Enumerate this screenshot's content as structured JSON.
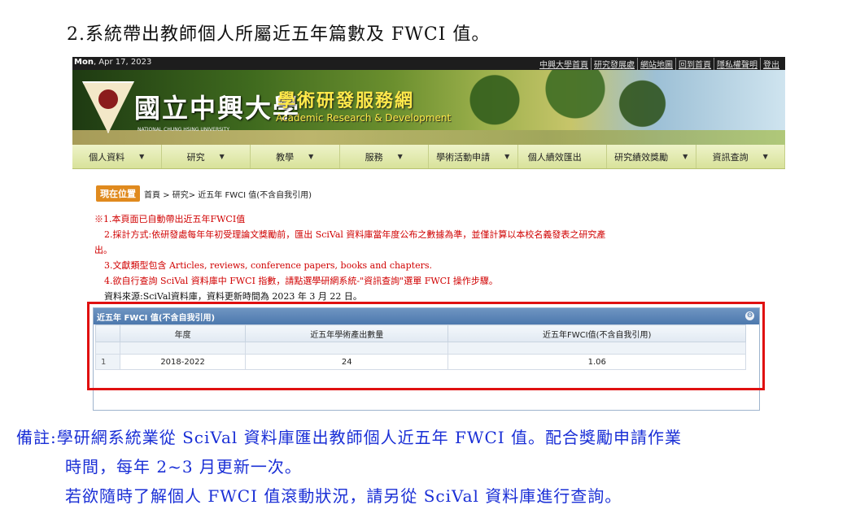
{
  "doc": {
    "heading": "2.系統帶出教師個人所屬近五年篇數及 FWCI 值。",
    "remark_line1": "備註:學研網系統業從 SciVal 資料庫匯出教師個人近五年 FWCI 值。配合獎勵申請作業",
    "remark_line2": "時間，每年 2~3 月更新一次。",
    "remark_line3": "若欲隨時了解個人 FWCI 值滾動狀況，請另從 SciVal 資料庫進行查詢。"
  },
  "site": {
    "day": "Mon",
    "date": ", Apr 17, 2023",
    "top_links": [
      "中興大學首頁",
      "研究發展處",
      "網站地圖",
      "回到首頁",
      "隱私權聲明",
      "登出"
    ],
    "univ_name": "國立中興大學",
    "univ_sub": "NATIONAL CHUNG HSING UNIVERSITY",
    "site_name": "學術研發服務網",
    "site_en": "Academic Research & Development",
    "menu": [
      {
        "label": "個人資料",
        "arrow": "▼"
      },
      {
        "label": "研究",
        "arrow": "▼"
      },
      {
        "label": "教學",
        "arrow": "▼"
      },
      {
        "label": "服務",
        "arrow": "▼"
      },
      {
        "label": "學術活動申請",
        "arrow": "▼"
      },
      {
        "label": "個人績效匯出",
        "arrow": ""
      },
      {
        "label": "研究績效獎勵",
        "arrow": "▼"
      },
      {
        "label": "資訊查詢",
        "arrow": "▼"
      }
    ],
    "breadcrumb_badge": "現在位置",
    "breadcrumb": "首頁 > 研究> 近五年 FWCI 值(不含自我引用)",
    "notes": {
      "n1": "※1.本頁面已自動帶出近五年FWCI值",
      "n2a": "2.採計方式:依研發處每年年初受理論文獎勵前，匯出 SciVal 資料庫當年度公布之數據為準，並僅計算以本校名義發表之研究產",
      "n2b": "出。",
      "n3": "3.文獻類型包含 Articles, reviews, conference papers, books and chapters.",
      "n4": "4.欲自行查詢 SciVal 資料庫中 FWCI 指數，請點選學研網系統-\"資訊查詢\"選單 FWCI 操作步驟。",
      "src": "資料來源:SciVal資料庫，資料更新時間為 2023 年 3 月 22 日。"
    },
    "panel": {
      "title": "近五年 FWCI 值(不含自我引用)",
      "collapse_icon": "⊖",
      "columns": [
        "年度",
        "近五年學術產出數量",
        "近五年FWCI值(不含自我引用)"
      ],
      "rows": [
        {
          "index": "1",
          "year": "2018-2022",
          "count": "24",
          "fwci": "1.06"
        }
      ]
    }
  }
}
